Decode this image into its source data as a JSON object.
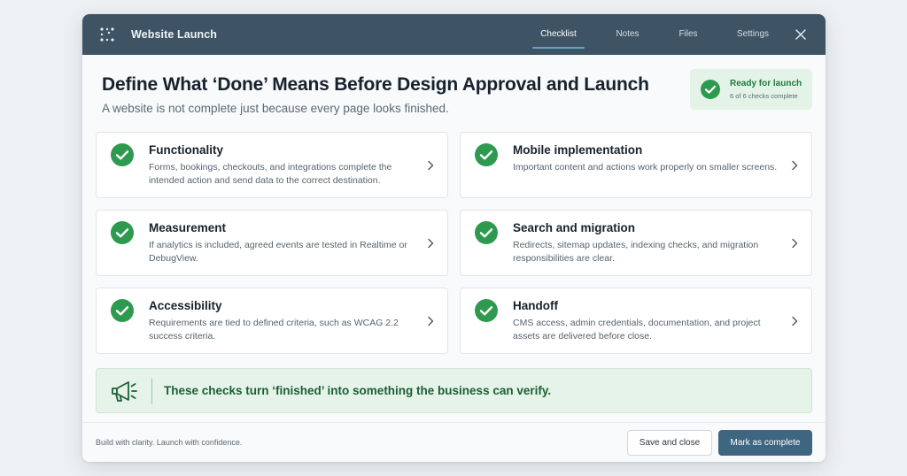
{
  "colors": {
    "topbar": "#3e5364",
    "accent_green": "#2e9a4f",
    "banner_bg": "#e5f3e8",
    "primary_button": "#3e6680"
  },
  "app": {
    "title": "Website Launch",
    "logo_icon": "dotted-grid-logo-icon"
  },
  "tabs": [
    {
      "label": "Checklist",
      "active": true
    },
    {
      "label": "Notes",
      "active": false
    },
    {
      "label": "Files",
      "active": false
    },
    {
      "label": "Settings",
      "active": false
    }
  ],
  "header": {
    "title": "Define What ‘Done’ Means Before Design Approval and Launch",
    "subtitle": "A website is not complete just because every page looks finished."
  },
  "status": {
    "title": "Ready for launch",
    "detail": "6 of 6 checks complete",
    "icon": "check-circle-icon"
  },
  "checks": [
    {
      "title": "Functionality",
      "description": "Forms, bookings, checkouts, and integrations complete the intended action and send data to the correct destination."
    },
    {
      "title": "Mobile implementation",
      "description": "Important content and actions work properly on smaller screens."
    },
    {
      "title": "Measurement",
      "description": "If analytics is included, agreed events are tested in Realtime or DebugView."
    },
    {
      "title": "Search and migration",
      "description": "Redirects, sitemap updates, indexing checks, and migration responsibilities are clear."
    },
    {
      "title": "Accessibility",
      "description": "Requirements are tied to defined criteria, such as WCAG 2.2 success criteria."
    },
    {
      "title": "Handoff",
      "description": "CMS access, admin credentials, documentation, and project assets are delivered before close."
    }
  ],
  "banner": {
    "text": "These checks turn ‘finished’ into something the business can verify.",
    "icon": "megaphone-icon"
  },
  "footer": {
    "tagline": "Build with clarity. Launch with confidence.",
    "save_label": "Save and close",
    "complete_label": "Mark as complete"
  }
}
